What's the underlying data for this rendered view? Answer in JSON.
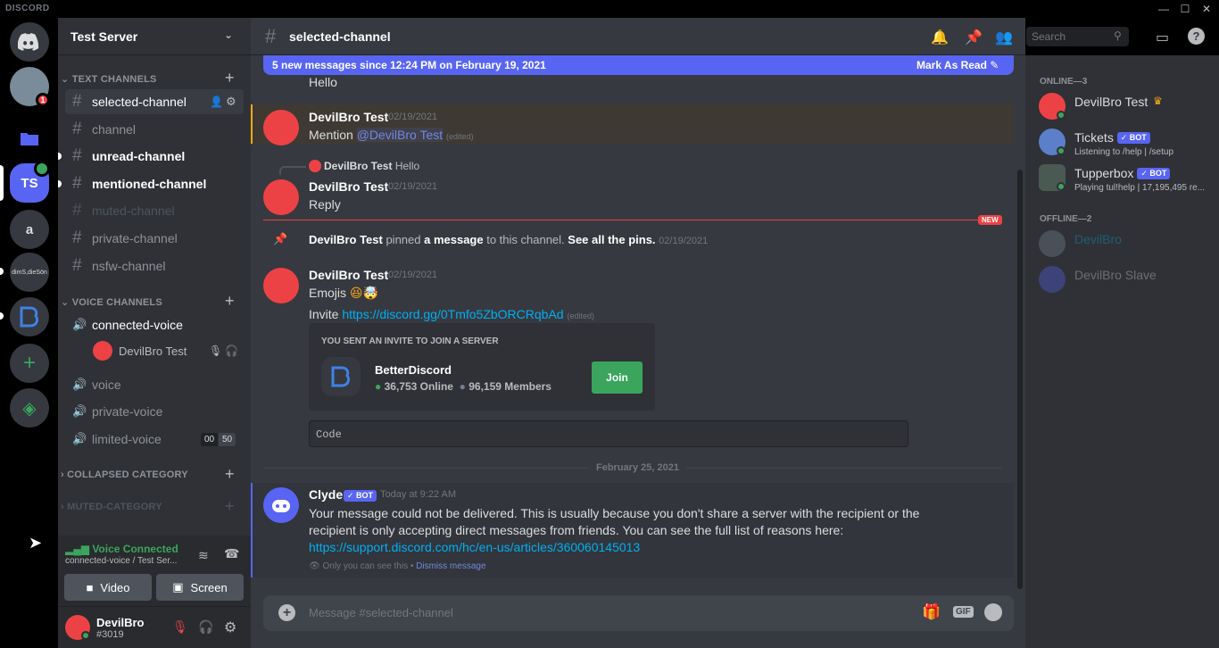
{
  "app": {
    "logo": "DISCORD"
  },
  "guilds": {
    "ts_acronym": "TS",
    "a_acronym": "a",
    "dimsd_acronym": "dimS,dieSön",
    "mention_count": "1"
  },
  "server": {
    "name": "Test Server"
  },
  "categories": {
    "text": "TEXT CHANNELS",
    "voice": "VOICE CHANNELS",
    "collapsed": "COLLAPSED CATEGORY",
    "muted": "MUTED-CATEGORY"
  },
  "channels": {
    "selected": "selected-channel",
    "channel": "channel",
    "unread": "unread-channel",
    "mentioned": "mentioned-channel",
    "muted": "muted-channel",
    "private": "private-channel",
    "nsfw": "nsfw-channel"
  },
  "voice_channels": {
    "connected": "connected-voice",
    "connected_user": "DevilBro Test",
    "voice": "voice",
    "private": "private-voice",
    "limited": "limited-voice",
    "limit_current": "00",
    "limit_max": "50"
  },
  "voice_panel": {
    "status": "Voice Connected",
    "location": "connected-voice / Test Ser...",
    "video": "Video",
    "screen": "Screen"
  },
  "user": {
    "name": "DevilBro",
    "tag": "#3019"
  },
  "header": {
    "channel": "selected-channel",
    "search_placeholder": "Search"
  },
  "banner": {
    "text": "5 new messages since 12:24 PM on February 19, 2021",
    "action": "Mark As Read"
  },
  "messages": {
    "m0": {
      "text": "Hello"
    },
    "m1": {
      "author": "DevilBro Test",
      "time": "02/19/2021",
      "text": "Mention ",
      "mention": "@DevilBro Test",
      "edited": "(edited)"
    },
    "m2": {
      "reply_author": "DevilBro Test",
      "reply_text": "Hello",
      "author": "DevilBro Test",
      "time": "02/19/2021",
      "text": "Reply"
    },
    "new_label": "NEW",
    "pin": {
      "author": "DevilBro Test",
      "t1": " pinned ",
      "t2": "a message",
      "t3": " to this channel. ",
      "t4": "See all the pins.",
      "time": "02/19/2021"
    },
    "m3": {
      "author": "DevilBro Test",
      "time": "02/19/2021",
      "emojis": "Emojis",
      "invite_label": "Invite ",
      "invite_link": "https://discord.gg/0Tmfo5ZbORCRqbAd",
      "edited": "(edited)"
    },
    "invite": {
      "heading": "YOU SENT AN INVITE TO JOIN A SERVER",
      "server": "BetterDiscord",
      "online": "36,753 Online",
      "members": "96,159 Members",
      "join": "Join"
    },
    "code": "Code",
    "divider": "February 25, 2021",
    "clyde": {
      "author": "Clyde",
      "bot": "BOT",
      "time": "Today at 9:22 AM",
      "text": "Your message could not be delivered. This is usually because you don't share a server with the recipient or the recipient is only accepting direct messages from friends. You can see the full list of reasons here: ",
      "link": "https://support.discord.com/hc/en-us/articles/360060145013",
      "only_you": "Only you can see this • ",
      "dismiss": "Dismiss message"
    }
  },
  "composer": {
    "placeholder": "Message #selected-channel",
    "gif": "GIF"
  },
  "members": {
    "online_header": "ONLINE—3",
    "offline_header": "OFFLINE—2",
    "online": [
      {
        "name": "DevilBro Test",
        "status": ""
      },
      {
        "name": "Tickets",
        "bot": "BOT",
        "status": "Listening to /help | /setup"
      },
      {
        "name": "Tupperbox",
        "bot": "BOT",
        "status": "Playing tul!help | 17,195,495 re..."
      }
    ],
    "offline": [
      {
        "name": "DevilBro"
      },
      {
        "name": "DevilBro Slave"
      }
    ]
  },
  "colors": {
    "accent": "#5865f2",
    "danger": "#ed4245",
    "online": "#3ba55d",
    "link": "#00aff4"
  }
}
